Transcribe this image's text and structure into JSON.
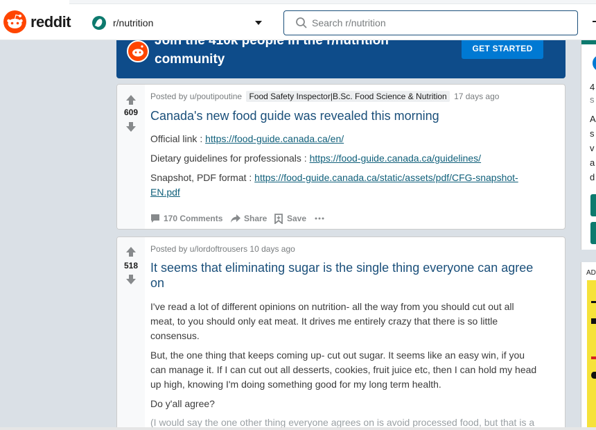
{
  "header": {
    "logo_text": "reddit",
    "subreddit": "r/nutrition",
    "search_placeholder": "Search r/nutrition"
  },
  "banner": {
    "text": "Join the 410k people in the r/nutrition community",
    "button": "GET STARTED"
  },
  "posts": [
    {
      "score": "609",
      "posted_by": "Posted by u/poutipoutine",
      "flair": "Food Safety Inspector|B.Sc. Food Science & Nutrition",
      "age": "17 days ago",
      "title": "Canada's new food guide was revealed this morning",
      "lines": [
        {
          "label": "Official link : ",
          "link": "https://food-guide.canada.ca/en/"
        },
        {
          "label": "Dietary guidelines for professionals : ",
          "link": "https://food-guide.canada.ca/guidelines/"
        },
        {
          "label": "Snapshot, PDF format : ",
          "link": "https://food-guide.canada.ca/static/assets/pdf/CFG-snapshot-",
          "link_cont": "EN.pdf"
        }
      ],
      "comments": "170 Comments",
      "share": "Share",
      "save": "Save"
    },
    {
      "score": "518",
      "posted_by": "Posted by u/lordoftrousers",
      "age": "10 days ago",
      "title_line1": "It seems that eliminating sugar is the single thing everyone can agree",
      "title_line2": "on",
      "para1": [
        "I've read a lot of different opinions on nutrition- all the way from you should cut out all",
        "meat, to you should only eat meat. It drives me entirely crazy that there is so little",
        "consensus."
      ],
      "para2": [
        "But, the one thing that keeps coming up- cut out sugar. It seems like an easy win, if you",
        "can manage it. If I can cut out all desserts, cookies, fruit juice etc, then I can hold my head",
        "up high, knowing I'm doing something good for my long term health."
      ],
      "para3": "Do y'all agree?",
      "para4": "(I would say the one other thing everyone agrees on is avoid processed food, but that is a"
    }
  ],
  "sidebar": {
    "count_partial": "4",
    "sub_partial": "s",
    "desc_partial": [
      "A",
      "s",
      "v",
      "a",
      "d"
    ],
    "ad_label": "ADV"
  }
}
